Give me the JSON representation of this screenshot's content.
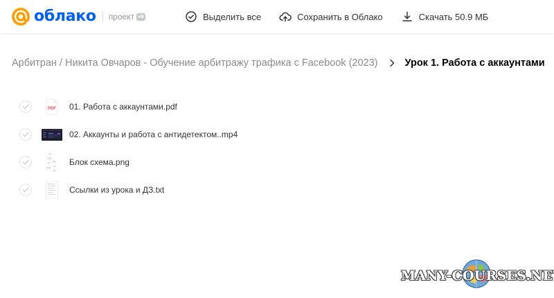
{
  "header": {
    "logo_text": "облако",
    "project_label": "проект",
    "vk_badge": "vk",
    "actions": {
      "select_all": "Выделить все",
      "save_to_cloud": "Сохранить в Облако",
      "download": "Скачать 50.9 МБ"
    }
  },
  "breadcrumb": {
    "parent": "Арбитран / Никита Овчаров - Обучение арбитражу трафика с Facebook (2023)",
    "current": "Урок 1. Работа с аккаунтами"
  },
  "files": [
    {
      "name": "01. Работа с аккаунтами.pdf",
      "type": "pdf",
      "thumb_label": "PDF",
      "icon": "pdf-icon"
    },
    {
      "name": "02. Аккаунты и работа с антидетектом..mp4",
      "type": "video",
      "icon": "video-thumbnail"
    },
    {
      "name": "Блок схема.png",
      "type": "image",
      "icon": "image-thumbnail"
    },
    {
      "name": "Ссылки из урока и ДЗ.txt",
      "type": "text",
      "icon": "text-file-icon"
    }
  ],
  "watermark": {
    "text": "MANY-COURSES.NET"
  },
  "colors": {
    "brand": "#005ff9",
    "logo_orange": "#ff9e00",
    "text": "#333333",
    "muted": "#8c8c8c",
    "pdf_red": "#ff4b4b",
    "video_dark": "#1b1d2e"
  }
}
